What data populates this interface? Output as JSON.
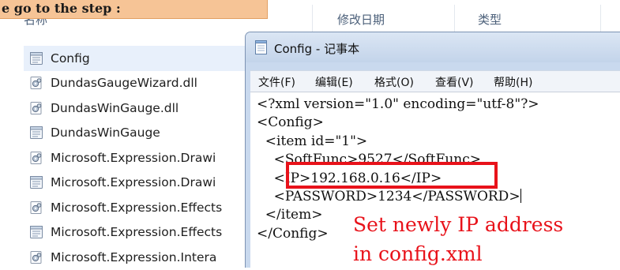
{
  "callout": {
    "text": "e go to the step :"
  },
  "explorer": {
    "columns": {
      "name": "名称",
      "modified": "修改日期",
      "type": "类型"
    },
    "files": [
      {
        "name": "Config",
        "icon": "config-file-icon",
        "selected": true
      },
      {
        "name": "DundasGaugeWizard.dll",
        "icon": "dll-file-icon"
      },
      {
        "name": "DundasWinGauge.dll",
        "icon": "dll-file-icon"
      },
      {
        "name": "DundasWinGauge",
        "icon": "config-file-icon"
      },
      {
        "name": "Microsoft.Expression.Drawi",
        "icon": "dll-file-icon"
      },
      {
        "name": "Microsoft.Expression.Drawi",
        "icon": "config-file-icon"
      },
      {
        "name": "Microsoft.Expression.Effects",
        "icon": "dll-file-icon"
      },
      {
        "name": "Microsoft.Expression.Effects",
        "icon": "config-file-icon"
      },
      {
        "name": "Microsoft.Expression.Intera",
        "icon": "dll-file-icon"
      }
    ]
  },
  "notepad": {
    "title": "Config - 记事本",
    "menu": [
      "文件(F)",
      "编辑(E)",
      "格式(O)",
      "查看(V)",
      "帮助(H)"
    ],
    "lines": [
      "<?xml version=\"1.0\" encoding=\"utf-8\"?>",
      "<Config>",
      "  <item id=\"1\">",
      "    <SoftFunc>9527</SoftFunc>",
      "    <IP>192.168.0.16</IP>",
      "    <PASSWORD>1234</PASSWORD>",
      "  </item>",
      "</Config>"
    ]
  },
  "annotation": {
    "line1": "Set newly IP address",
    "line2": "in config.xml"
  },
  "colors": {
    "highlight": "#e8121a",
    "callout_bg": "#f6c496",
    "accent": "#4c607a"
  }
}
